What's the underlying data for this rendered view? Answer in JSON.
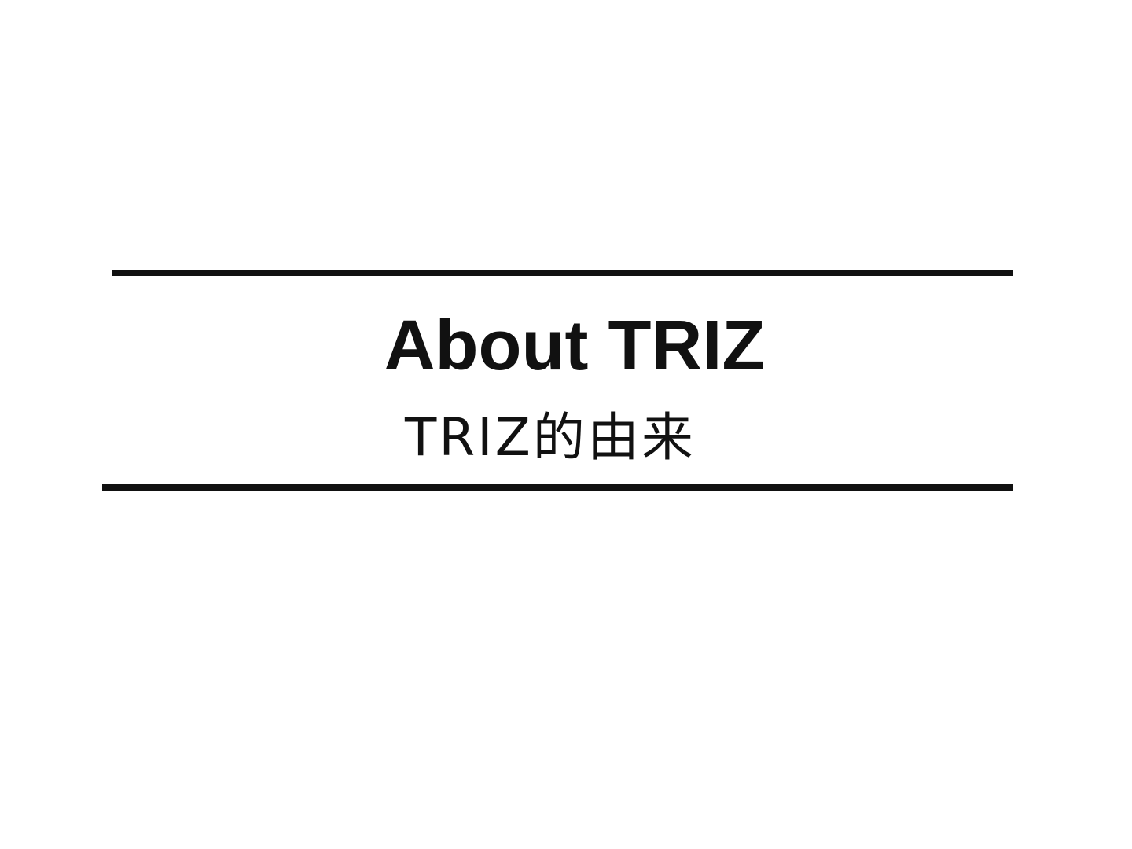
{
  "slide": {
    "title": "About TRIZ",
    "subtitle": "TRIZ的由来"
  }
}
